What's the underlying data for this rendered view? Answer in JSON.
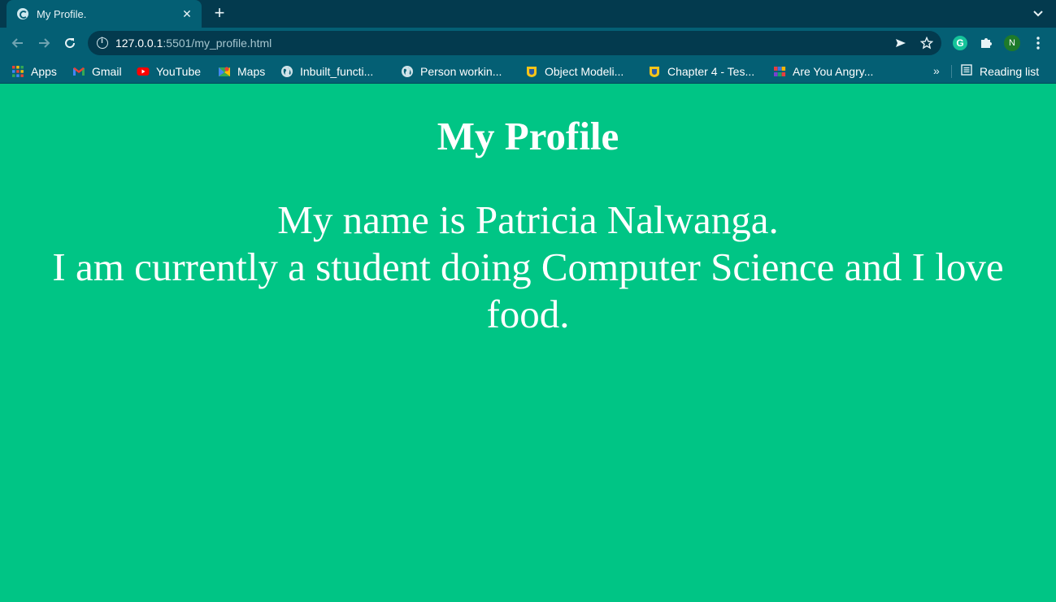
{
  "browser": {
    "tab": {
      "title": "My Profile.",
      "close_label": "✕"
    },
    "new_tab_label": "+",
    "url": {
      "host": "127.0.0.1",
      "rest": ":5501/my_profile.html"
    },
    "profile_initial": "N",
    "grammarly_initial": "G"
  },
  "bookmarks": {
    "items": [
      {
        "label": "Apps",
        "icon": "apps-grid-icon"
      },
      {
        "label": "Gmail",
        "icon": "gmail-icon"
      },
      {
        "label": "YouTube",
        "icon": "youtube-icon"
      },
      {
        "label": "Maps",
        "icon": "maps-icon"
      },
      {
        "label": "Inbuilt_functi...",
        "icon": "globe-icon"
      },
      {
        "label": "Person workin...",
        "icon": "globe-icon"
      },
      {
        "label": "Object Modeli...",
        "icon": "bookmark-site-icon"
      },
      {
        "label": "Chapter 4 - Tes...",
        "icon": "bookmark-site-icon"
      },
      {
        "label": "Are You Angry...",
        "icon": "colorful-grid-icon"
      }
    ],
    "overflow_label": "»",
    "reading_list_label": "Reading list"
  },
  "page": {
    "heading": "My Profile",
    "line1": "My name is Patricia Nalwanga.",
    "line2": "I am currently a student doing Computer Science and I love food."
  },
  "colors": {
    "page_bg": "#00c585",
    "chrome_dark": "#033a4e",
    "chrome_light": "#045f74"
  }
}
